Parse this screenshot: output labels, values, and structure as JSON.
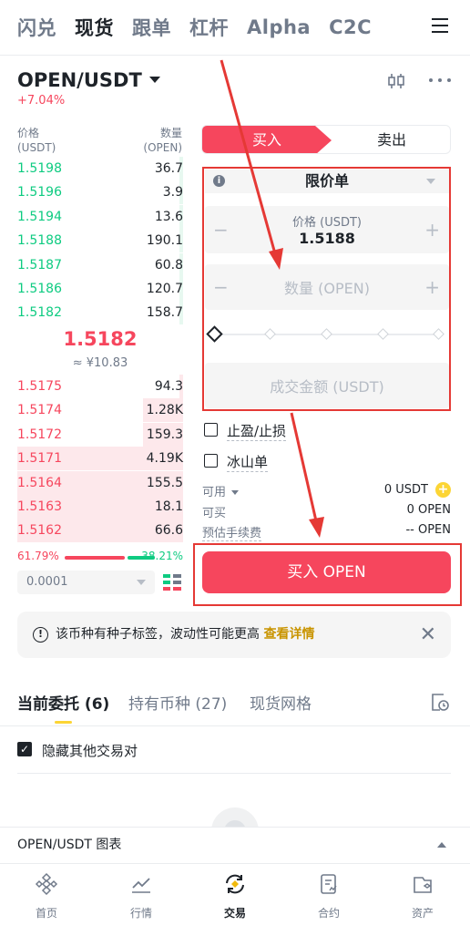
{
  "top_nav": {
    "tabs": [
      "闪兑",
      "现货",
      "跟单",
      "杠杆",
      "Alpha",
      "C2C"
    ],
    "active_index": 1
  },
  "pair": {
    "name": "OPEN/USDT",
    "change": "+7.04%"
  },
  "orderbook": {
    "price_header": "价格",
    "price_unit": "(USDT)",
    "qty_header": "数量",
    "qty_unit": "(OPEN)",
    "bids": [
      {
        "price": "1.5198",
        "qty": "36.7",
        "depth": 0.02
      },
      {
        "price": "1.5196",
        "qty": "3.9",
        "depth": 0.02
      },
      {
        "price": "1.5194",
        "qty": "13.6",
        "depth": 0.02
      },
      {
        "price": "1.5188",
        "qty": "190.1",
        "depth": 0.02
      },
      {
        "price": "1.5187",
        "qty": "60.8",
        "depth": 0.02
      },
      {
        "price": "1.5186",
        "qty": "120.7",
        "depth": 0.02
      },
      {
        "price": "1.5182",
        "qty": "158.7",
        "depth": 0.02
      }
    ],
    "last_price": "1.5182",
    "last_fiat": "≈ ¥10.83",
    "asks": [
      {
        "price": "1.5175",
        "qty": "94.3",
        "depth": 0.02
      },
      {
        "price": "1.5174",
        "qty": "1.28K",
        "depth": 0.24
      },
      {
        "price": "1.5172",
        "qty": "159.3",
        "depth": 0.24
      },
      {
        "price": "1.5171",
        "qty": "4.19K",
        "depth": 1.0
      },
      {
        "price": "1.5164",
        "qty": "155.5",
        "depth": 1.0
      },
      {
        "price": "1.5163",
        "qty": "18.1",
        "depth": 1.0
      },
      {
        "price": "1.5162",
        "qty": "66.6",
        "depth": 1.0
      }
    ],
    "buy_ratio": "61.79%",
    "sell_ratio": "38.21%",
    "precision": "0.0001"
  },
  "trade_form": {
    "buy_tab": "买入",
    "sell_tab": "卖出",
    "order_type": "限价单",
    "price_label": "价格 (USDT)",
    "price_value": "1.5188",
    "qty_placeholder": "数量 (OPEN)",
    "total_placeholder": "成交金额 (USDT)",
    "slider_percent": 0,
    "tp_sl_label": "止盈/止损",
    "iceberg_label": "冰山单",
    "available_label": "可用",
    "available_value": "0 USDT",
    "can_buy_label": "可买",
    "can_buy_value": "0 OPEN",
    "fee_label": "预估手续费",
    "fee_value": "-- OPEN",
    "buy_button": "买入 OPEN"
  },
  "notice": {
    "text": "该币种有种子标签，波动性可能更高",
    "link": "查看详情"
  },
  "orders": {
    "tabs": [
      "当前委托 (6)",
      "持有币种 (27)",
      "现货网格"
    ],
    "active_index": 0,
    "hide_other_pairs": "隐藏其他交易对"
  },
  "chart_bar": {
    "label": "OPEN/USDT 图表"
  },
  "bottom_nav": {
    "items": [
      "首页",
      "行情",
      "交易",
      "合约",
      "资产"
    ],
    "active_index": 2
  },
  "colors": {
    "buy": "#f6465d",
    "sell": "#0ecb81",
    "accent": "#fcd535",
    "annotation": "#e53935"
  }
}
